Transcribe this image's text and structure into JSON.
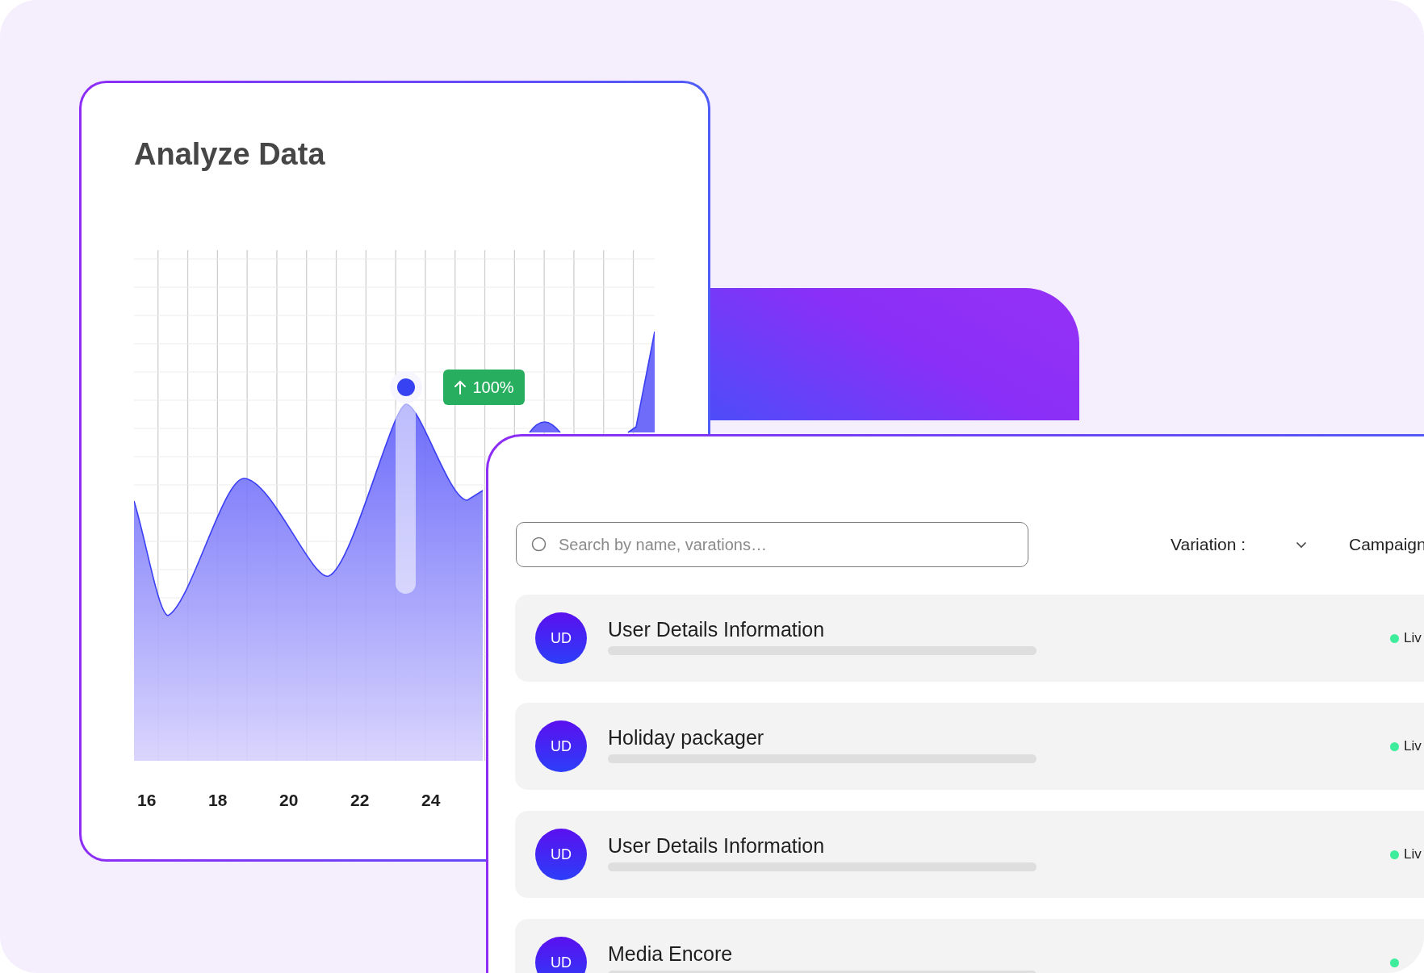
{
  "chart_card": {
    "title": "Analyze Data",
    "badge": {
      "value": "100%"
    },
    "x_labels": [
      "16",
      "18",
      "20",
      "22",
      "24"
    ]
  },
  "list_card": {
    "search": {
      "placeholder": "Search by name, varations…"
    },
    "filters": [
      {
        "label": "Variation :",
        "kind": "dropdown"
      },
      {
        "label": "Campaign",
        "kind": "text"
      }
    ],
    "rows": [
      {
        "avatar": "UD",
        "title": "User Details Information",
        "status": "Liv"
      },
      {
        "avatar": "UD",
        "title": "Holiday packager",
        "status": "Liv"
      },
      {
        "avatar": "UD",
        "title": "User Details Information",
        "status": "Liv"
      },
      {
        "avatar": "UD",
        "title": "Media Encore"
      }
    ]
  }
}
